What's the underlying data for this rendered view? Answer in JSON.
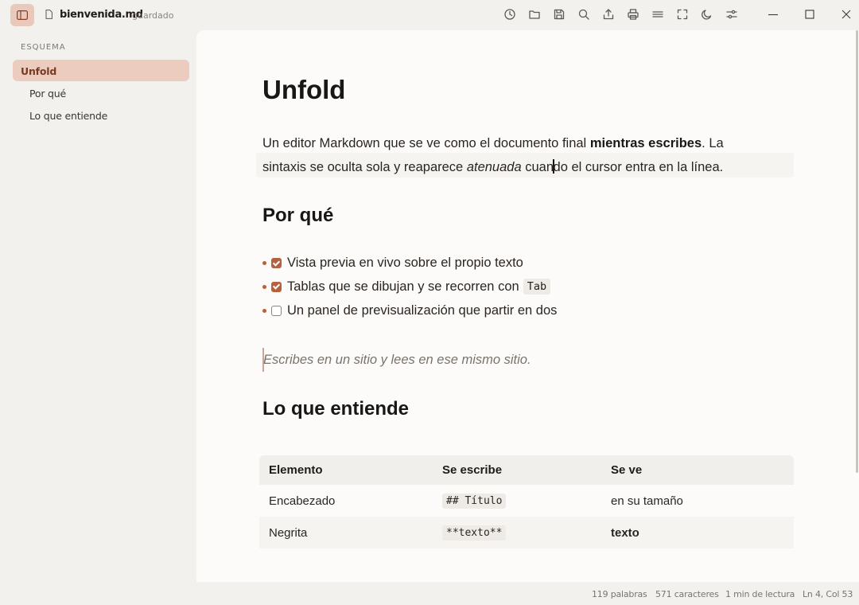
{
  "titlebar": {
    "file_name": "bienvenida.md",
    "file_status": "guardado",
    "tools": [
      "history-icon",
      "folder-icon",
      "save-icon",
      "search-icon",
      "export-icon",
      "print-icon",
      "line-width-icon",
      "fullscreen-icon",
      "dark-mode-icon",
      "settings-sliders-icon"
    ],
    "window_controls": [
      "minimize-icon",
      "maximize-icon",
      "close-icon"
    ]
  },
  "outline": {
    "title": "ESQUEMA",
    "items": [
      {
        "label": "Unfold",
        "level": 1,
        "active": true
      },
      {
        "label": "Por qué",
        "level": 2
      },
      {
        "label": "Lo que entiende",
        "level": 2
      }
    ]
  },
  "document": {
    "h1": "Unfold",
    "paragraph": {
      "part1": "Un editor Markdown que se ve como el documento final ",
      "bold": "mientras escribes",
      "part2": ". La sintaxis se oculta sola y reaparece ",
      "italic": "atenuada",
      "part3a": " cuan",
      "part3b": "do el cursor entra en la línea."
    },
    "h2_why": "Por qué",
    "tasks": [
      {
        "text": "Vista previa en vivo sobre el propio texto",
        "checked": true
      },
      {
        "text": "Tablas que se dibujan y se recorren con ",
        "code": "Tab",
        "checked": true
      },
      {
        "text": "Un panel de previsualización que partir en dos",
        "checked": false
      }
    ],
    "quote": "Escribes en un sitio y lees en ese mismo sitio.",
    "h2_understands": "Lo que entiende",
    "table": {
      "headers": [
        "Elemento",
        "Se escribe",
        "Se ve"
      ],
      "rows": [
        [
          "Encabezado",
          "## Título",
          "en su tamaño"
        ],
        [
          "Negrita",
          "**texto**",
          "texto"
        ]
      ]
    }
  },
  "status": {
    "words": "119 palabras",
    "chars": "571 caracteres",
    "reading": "1 min de lectura",
    "position": "Ln 4, Col 53"
  },
  "colors": {
    "accent": "#b5613d",
    "sidebar_active_bg": "#ecccbf",
    "editor_bg": "#fcfbf9",
    "chrome_bg": "#f3f1ee"
  }
}
